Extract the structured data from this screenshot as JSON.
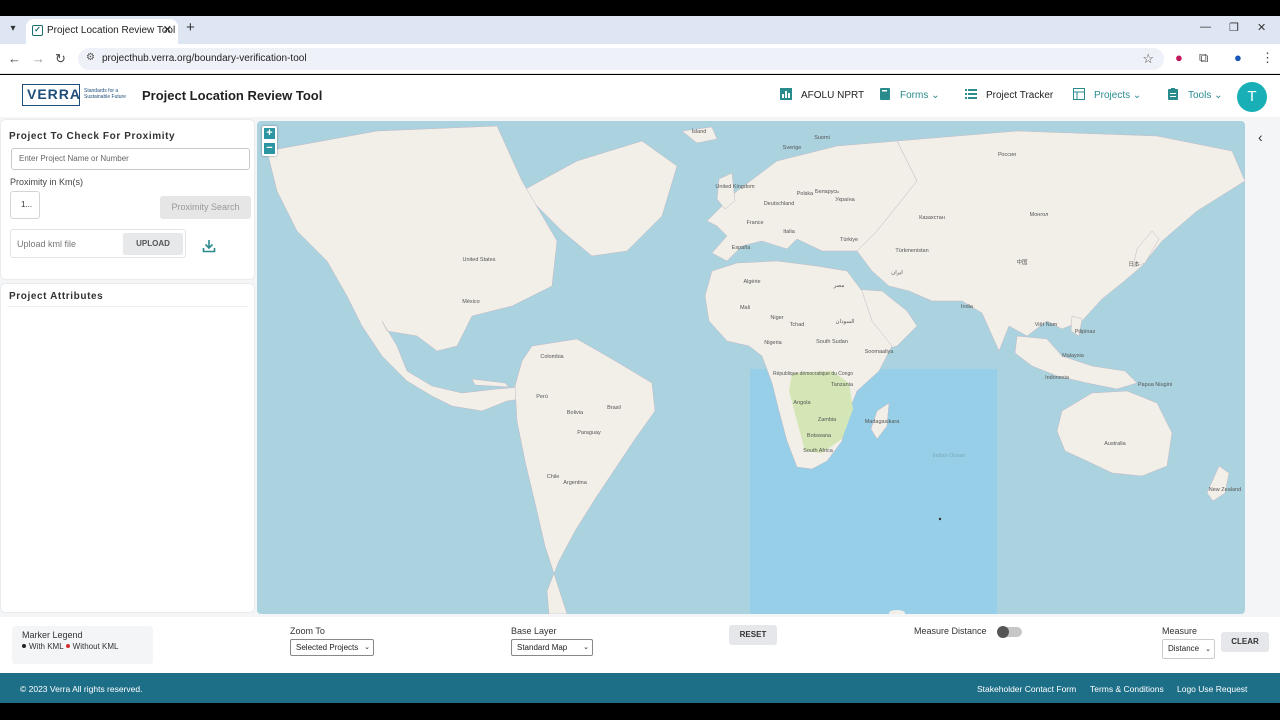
{
  "browser": {
    "tab_title": "Project Location Review Tool",
    "url": "projecthub.verra.org/boundary-verification-tool"
  },
  "header": {
    "logo_text": "VERRA",
    "logo_tagline": "Standards for a Sustainable Future",
    "title": "Project Location Review Tool",
    "nav": {
      "afolu": "AFOLU NPRT",
      "forms": "Forms",
      "tracker": "Project Tracker",
      "projects": "Projects",
      "tools": "Tools"
    },
    "avatar_initial": "T"
  },
  "proximity_panel": {
    "title": "Project To Check For Proximity",
    "project_placeholder": "Enter Project Name or Number",
    "proximity_label": "Proximity in Km(s)",
    "proximity_value": "1...",
    "search_button": "Proximity Search",
    "upload_placeholder": "Upload kml file",
    "upload_button": "UPLOAD"
  },
  "attributes_panel": {
    "title": "Project Attributes"
  },
  "map": {
    "zoom_in": "+",
    "zoom_out": "−",
    "labels": {
      "iceland": "Ísland",
      "sverige": "Sverige",
      "suomi": "Suomi",
      "rossiya": "Россия",
      "uk": "United Kingdom",
      "deutschland": "Deutschland",
      "polska": "Polska",
      "belarus": "Беларусь",
      "ukraina": "Україна",
      "france": "France",
      "italia": "Italia",
      "espana": "España",
      "turkiye": "Türkiye",
      "kazakhstan": "Казахстан",
      "mongolia": "Монгол",
      "turkmenistan": "Türkmenistan",
      "china": "中国",
      "japan": "日本",
      "iran": "ایران",
      "india": "India",
      "vietnam": "Việt Nam",
      "pilipinas": "Pilipinas",
      "malaysia": "Malaysia",
      "indonesia": "Indonesia",
      "png": "Papua Niugini",
      "australia": "Australia",
      "new_zealand": "New Zealand",
      "united_states": "United States",
      "mexico": "México",
      "colombia": "Colombia",
      "peru": "Perú",
      "brasil": "Brasil",
      "bolivia": "Bolivia",
      "paraguay": "Paraguay",
      "chile": "Chile",
      "argentina": "Argentina",
      "algerie": "Algérie",
      "mali": "Mali",
      "niger": "Niger",
      "tchad": "Tchad",
      "nigeria": "Nigeria",
      "misr": "مصر",
      "sudan": "السودان",
      "south_sudan": "South Sudan",
      "somalia": "Soomaaliya",
      "drc": "République démocratique du Congo",
      "tanzania": "Tanzania",
      "angola": "Angola",
      "zambia": "Zambia",
      "madagascar": "Madagasikara",
      "botswana": "Botswana",
      "south_africa": "South Africa",
      "indian_ocean": "Indian Ocean"
    }
  },
  "controls": {
    "legend_title": "Marker Legend",
    "legend_with": "With KML",
    "legend_without": "Without KML",
    "zoom_to_label": "Zoom To",
    "zoom_to_value": "Selected Projects",
    "base_layer_label": "Base Layer",
    "base_layer_value": "Standard Map",
    "reset_button": "RESET",
    "measure_distance_label": "Measure Distance",
    "measure_label": "Measure",
    "measure_value": "Distance",
    "clear_button": "CLEAR"
  },
  "footer": {
    "copyright": "© 2023 Verra All rights reserved.",
    "links": [
      "Stakeholder Contact Form",
      "Terms & Conditions",
      "Logo Use Request"
    ]
  },
  "colors": {
    "brand_teal": "#1d6f88",
    "accent_teal": "#2a8b8c",
    "avatar": "#18b0b6",
    "ocean": "#aad3df",
    "land": "#f2efe9",
    "highlight": "#8fcdea"
  }
}
